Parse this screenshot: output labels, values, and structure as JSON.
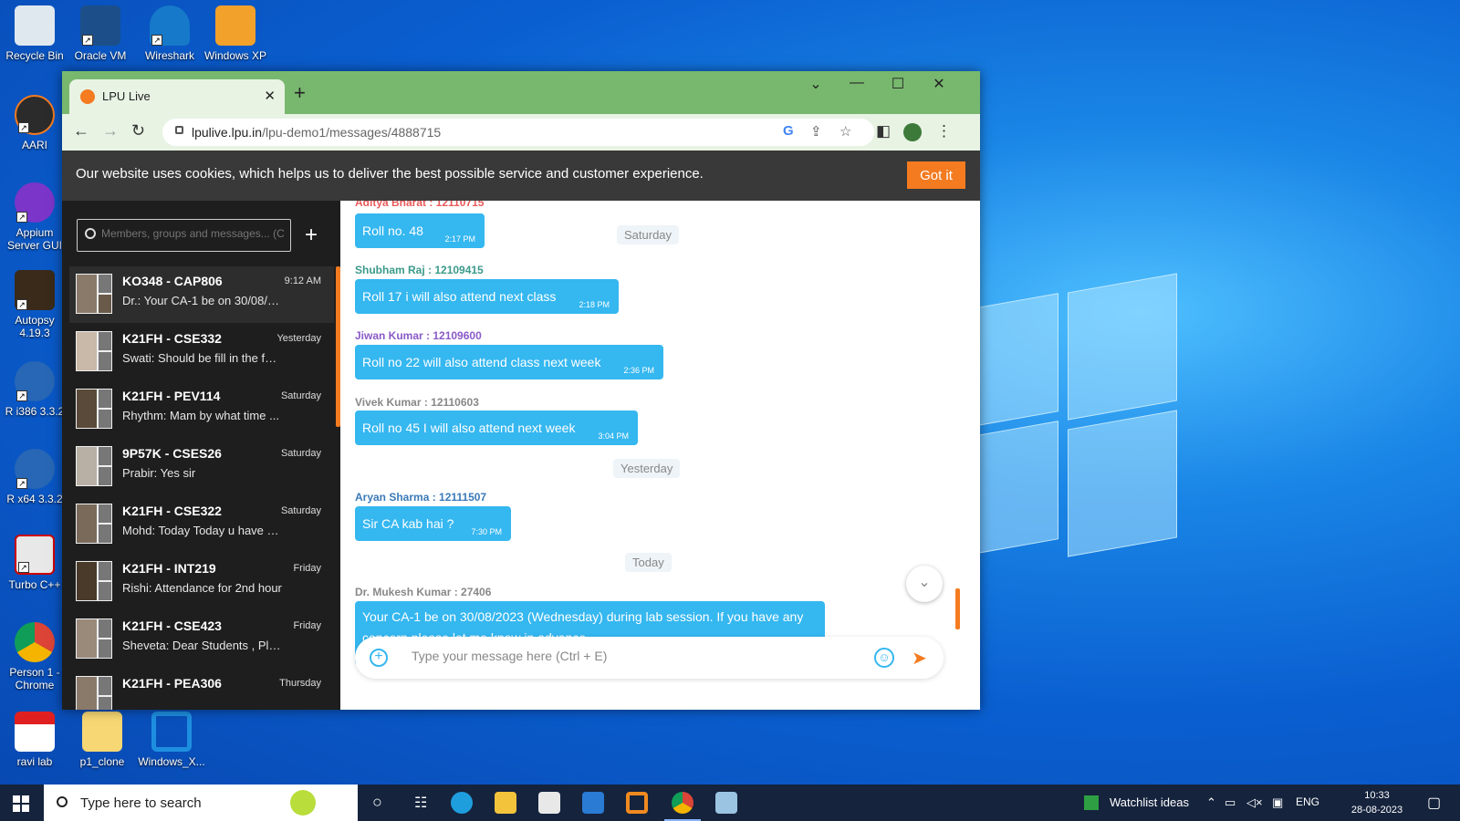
{
  "desktop": {
    "icons_left": [
      {
        "label": "Recycle Bin"
      },
      {
        "label": "AARI"
      },
      {
        "label": "Appium Server GUI"
      },
      {
        "label": "Autopsy 4.19.3"
      },
      {
        "label": "R i386 3.3.2"
      },
      {
        "label": "R x64 3.3.2"
      },
      {
        "label": "Turbo C++"
      },
      {
        "label": "Person 1 - Chrome"
      },
      {
        "label": "ravi lab"
      }
    ],
    "icons_top": [
      {
        "label": "Oracle VM"
      },
      {
        "label": "Wireshark"
      },
      {
        "label": "Windows XP"
      }
    ],
    "icons_bottom": [
      {
        "label": "p1_clone"
      },
      {
        "label": "Windows_X..."
      }
    ]
  },
  "browser": {
    "tab_title": "LPU Live",
    "url_host": "lpulive.lpu.in",
    "url_path": "/lpu-demo1/messages/4888715",
    "accent": "#f47b20"
  },
  "cookie_banner": {
    "text": "Our website uses cookies, which helps us to deliver the best possible service and customer experience.",
    "button": "Got it"
  },
  "sidebar": {
    "search_placeholder": "Members, groups and messages... (C",
    "chats": [
      {
        "name": "KO348 - CAP806",
        "preview": "Dr.: Your CA-1 be on 30/08/2...",
        "time": "9:12 AM"
      },
      {
        "name": "K21FH - CSE332",
        "preview": "Swati: Should be fill in the form",
        "time": "Yesterday"
      },
      {
        "name": "K21FH - PEV114",
        "preview": "Rhythm: Mam by what time ...",
        "time": "Saturday"
      },
      {
        "name": "9P57K - CSES26",
        "preview": "Prabir: Yes sir",
        "time": "Saturday"
      },
      {
        "name": "K21FH - CSE322",
        "preview": "Mohd: Today Today u have do...",
        "time": "Saturday"
      },
      {
        "name": "K21FH - INT219",
        "preview": "Rishi: Attendance for 2nd hour",
        "time": "Friday"
      },
      {
        "name": "K21FH - CSE423",
        "preview": "Sheveta: Dear Students , Plea...",
        "time": "Friday"
      },
      {
        "name": "K21FH - PEA306",
        "preview": "",
        "time": "Thursday"
      }
    ]
  },
  "messages": {
    "items": [
      {
        "sender": "Aditya Bharat : 12110715",
        "text": "Roll no. 48",
        "time": "2:17 PM"
      },
      {
        "sender": "Shubham Raj : 12109415",
        "text": "Roll 17 i will also attend next class",
        "time": "2:18 PM"
      },
      {
        "sender": "Jiwan Kumar : 12109600",
        "text": "Roll no 22 will also attend class next week",
        "time": "2:36 PM"
      },
      {
        "sender": "Vivek Kumar : 12110603",
        "text": "Roll no 45 I will also attend next week",
        "time": "3:04 PM"
      },
      {
        "sender": "Aryan Sharma : 12111507",
        "text": "Sir CA kab hai ?",
        "time": "7:30 PM"
      },
      {
        "sender": "Dr. Mukesh Kumar : 27406",
        "text_line1": "Your CA-1 be on 30/08/2023 (Wednesday) during lab session. If you have any",
        "text_line2": "concern please let me know in advance.",
        "time": ""
      }
    ],
    "dates": [
      "Saturday",
      "Yesterday",
      "Today"
    ],
    "compose_placeholder": "Type your message here (Ctrl + E)"
  },
  "taskbar": {
    "search_placeholder": "Type here to search",
    "watchlist": "Watchlist ideas",
    "lang": "ENG",
    "time": "10:33",
    "date": "28-08-2023"
  }
}
